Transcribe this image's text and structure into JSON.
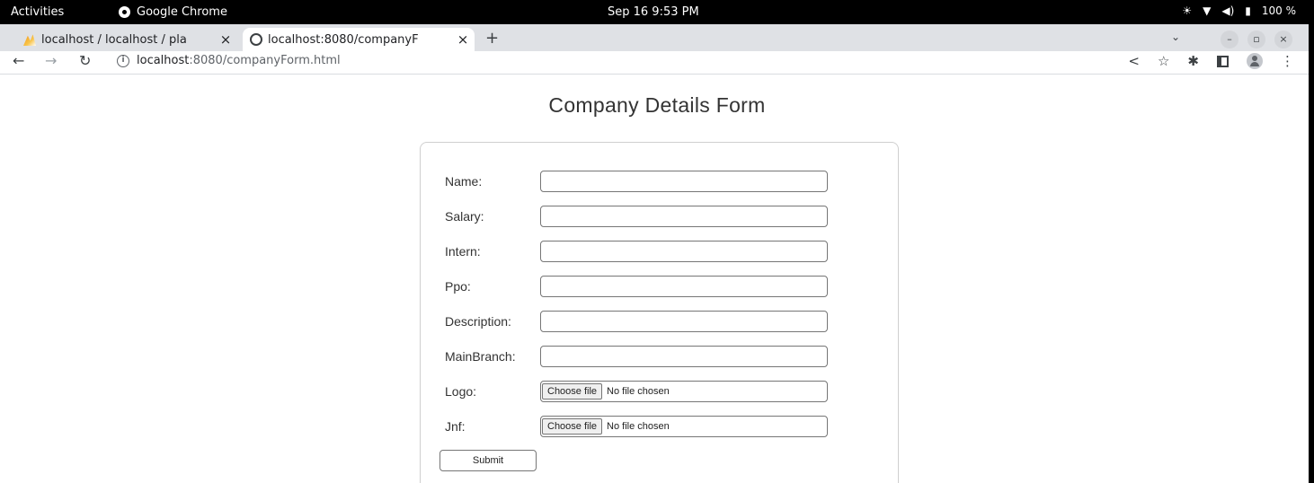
{
  "os_bar": {
    "activities": "Activities",
    "app_name": "Google Chrome",
    "clock": "Sep 16  9:53 PM",
    "battery": "100 %"
  },
  "tabs": [
    {
      "title": "localhost / localhost / pla",
      "active": false,
      "favicon": "phpmyadmin-icon"
    },
    {
      "title": "localhost:8080/companyF",
      "active": true,
      "favicon": "globe-icon"
    }
  ],
  "address_bar": {
    "host": "localhost",
    "path": ":8080/companyForm.html"
  },
  "page": {
    "title": "Company Details Form",
    "fields": [
      {
        "label": "Name:",
        "type": "text",
        "value": ""
      },
      {
        "label": "Salary:",
        "type": "text",
        "value": ""
      },
      {
        "label": "Intern:",
        "type": "text",
        "value": ""
      },
      {
        "label": "Ppo:",
        "type": "text",
        "value": ""
      },
      {
        "label": "Description:",
        "type": "text",
        "value": ""
      },
      {
        "label": "MainBranch:",
        "type": "text",
        "value": ""
      },
      {
        "label": "Logo:",
        "type": "file",
        "button": "Choose file",
        "status": "No file chosen"
      },
      {
        "label": "Jnf:",
        "type": "file",
        "button": "Choose file",
        "status": "No file chosen"
      }
    ],
    "submit_label": "Submit"
  }
}
